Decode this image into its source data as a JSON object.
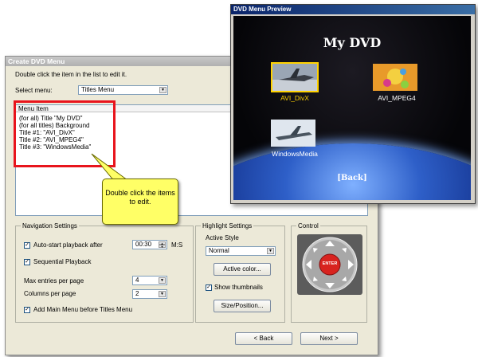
{
  "dialog": {
    "title": "Create DVD Menu",
    "instruction": "Double click the item in the list to edit it.",
    "select_menu_label": "Select menu:",
    "select_menu_value": "Titles Menu",
    "list_header": "Menu Item",
    "list_items": [
      "(for all) Title \"My DVD\"",
      "(for all titles) Background",
      "Title #1: \"AVI_DivX\"",
      "Title #2: \"AVI_MPEG4\"",
      "Title #3: \"WindowsMedia\""
    ],
    "nav": {
      "label": "Navigation Settings",
      "autostart_label": "Auto-start playback after",
      "autostart_checked": true,
      "autostart_value": "00:30",
      "time_unit": "M:S",
      "sequential_label": "Sequential Playback",
      "sequential_checked": true,
      "max_entries_label": "Max entries per page",
      "max_entries_value": "4",
      "columns_label": "Columns per page",
      "columns_value": "2",
      "add_main_label": "Add Main Menu before Titles Menu",
      "add_main_checked": true
    },
    "highlight": {
      "label": "Highlight Settings",
      "active_style_label": "Active Style",
      "active_style_value": "Normal",
      "active_color_button": "Active color...",
      "show_thumbnails_label": "Show thumbnails",
      "show_thumbnails_checked": true,
      "size_position_button": "Size/Position..."
    },
    "control": {
      "label": "Control",
      "enter_label": "ENTER"
    },
    "back_button": "< Back",
    "next_button": "Next >"
  },
  "callout": {
    "text": "Double click the items to edit."
  },
  "preview": {
    "title": "DVD Menu Preview",
    "dvd_title": "My DVD",
    "titles": [
      {
        "caption": "AVI_DivX",
        "selected": true
      },
      {
        "caption": "AVI_MPEG4",
        "selected": false
      },
      {
        "caption": "WindowsMedia",
        "selected": false
      }
    ],
    "back_label": "[Back]"
  },
  "colors": {
    "highlight_box": "#e8141c",
    "selected_caption": "#ffd200",
    "callout_fill": "#ffff66",
    "preview_titlebar": "#0a246a"
  }
}
